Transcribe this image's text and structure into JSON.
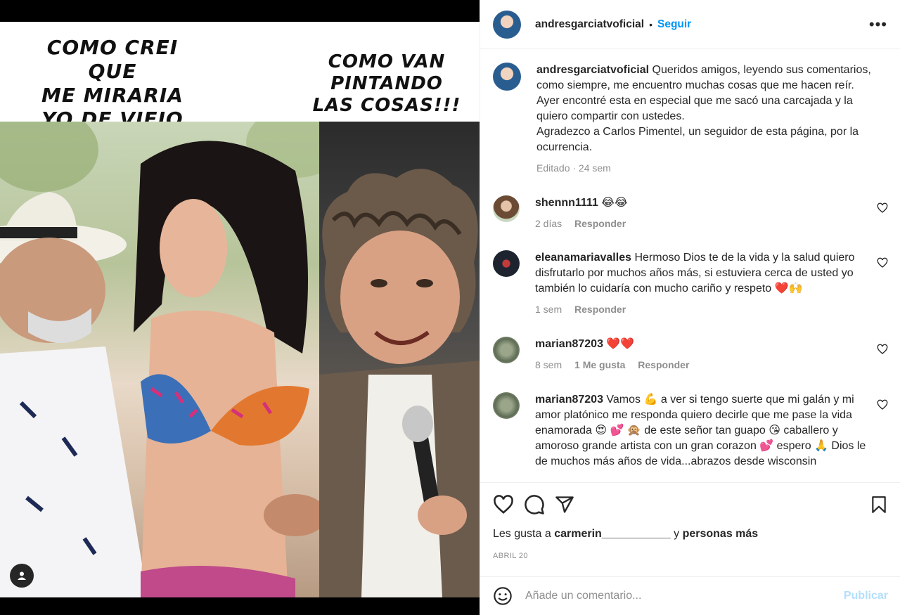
{
  "media": {
    "caption_left": "COMO CREI QUE\nME MIRARIA\nYO DE VIEJO",
    "caption_right": "COMO VAN PINTANDO\nLAS COSAS!!!"
  },
  "header": {
    "username": "andresgarciatvoficial",
    "separator": "•",
    "follow_label": "Seguir",
    "more_label": "•••"
  },
  "post": {
    "username": "andresgarciatvoficial",
    "caption": "Queridos amigos, leyendo sus comentarios, como siempre, me encuentro muchas cosas que me hacen reír. Ayer encontré esta en especial que me sacó una carcajada y la quiero compartir con ustedes.",
    "caption_2": "Agradezco a Carlos Pimentel, un seguidor de esta página, por la ocurrencia.",
    "meta": "Editado · 24 sem"
  },
  "comments": [
    {
      "username": "shennn1111",
      "text": "😂😂",
      "time": "2 días",
      "likes": "",
      "reply": "Responder"
    },
    {
      "username": "eleanamariavalles",
      "text": "Hermoso Dios te de la vida y la salud quiero disfrutarlo por muchos años más, si estuviera cerca de usted yo también lo cuidaría con mucho cariño y respeto ❤️🙌",
      "time": "1 sem",
      "likes": "",
      "reply": "Responder"
    },
    {
      "username": "marian87203",
      "text": "❤️❤️",
      "time": "8 sem",
      "likes": "1 Me gusta",
      "reply": "Responder"
    },
    {
      "username": "marian87203",
      "text": "Vamos 💪 a ver si tengo suerte que mi galán y mi amor platónico me responda quiero decirle que me pase la vida enamorada 😍 💕 🙊 de este señor tan guapo 😘 caballero y amoroso grande artista con un gran corazon 💕 espero 🙏 Dios le de muchos más años de vida...abrazos desde wisconsin",
      "time": "",
      "likes": "",
      "reply": ""
    }
  ],
  "likes": {
    "prefix": "Les gusta a",
    "user": "carmerin___________",
    "conj": "y",
    "others": "personas más"
  },
  "date": "ABRIL 20",
  "add_comment": {
    "placeholder": "Añade un comentario...",
    "publish_label": "Publicar"
  },
  "colors": {
    "accent": "#0095f6",
    "publish_disabled": "#b2dffc",
    "secondary_text": "#8e8e8e"
  }
}
